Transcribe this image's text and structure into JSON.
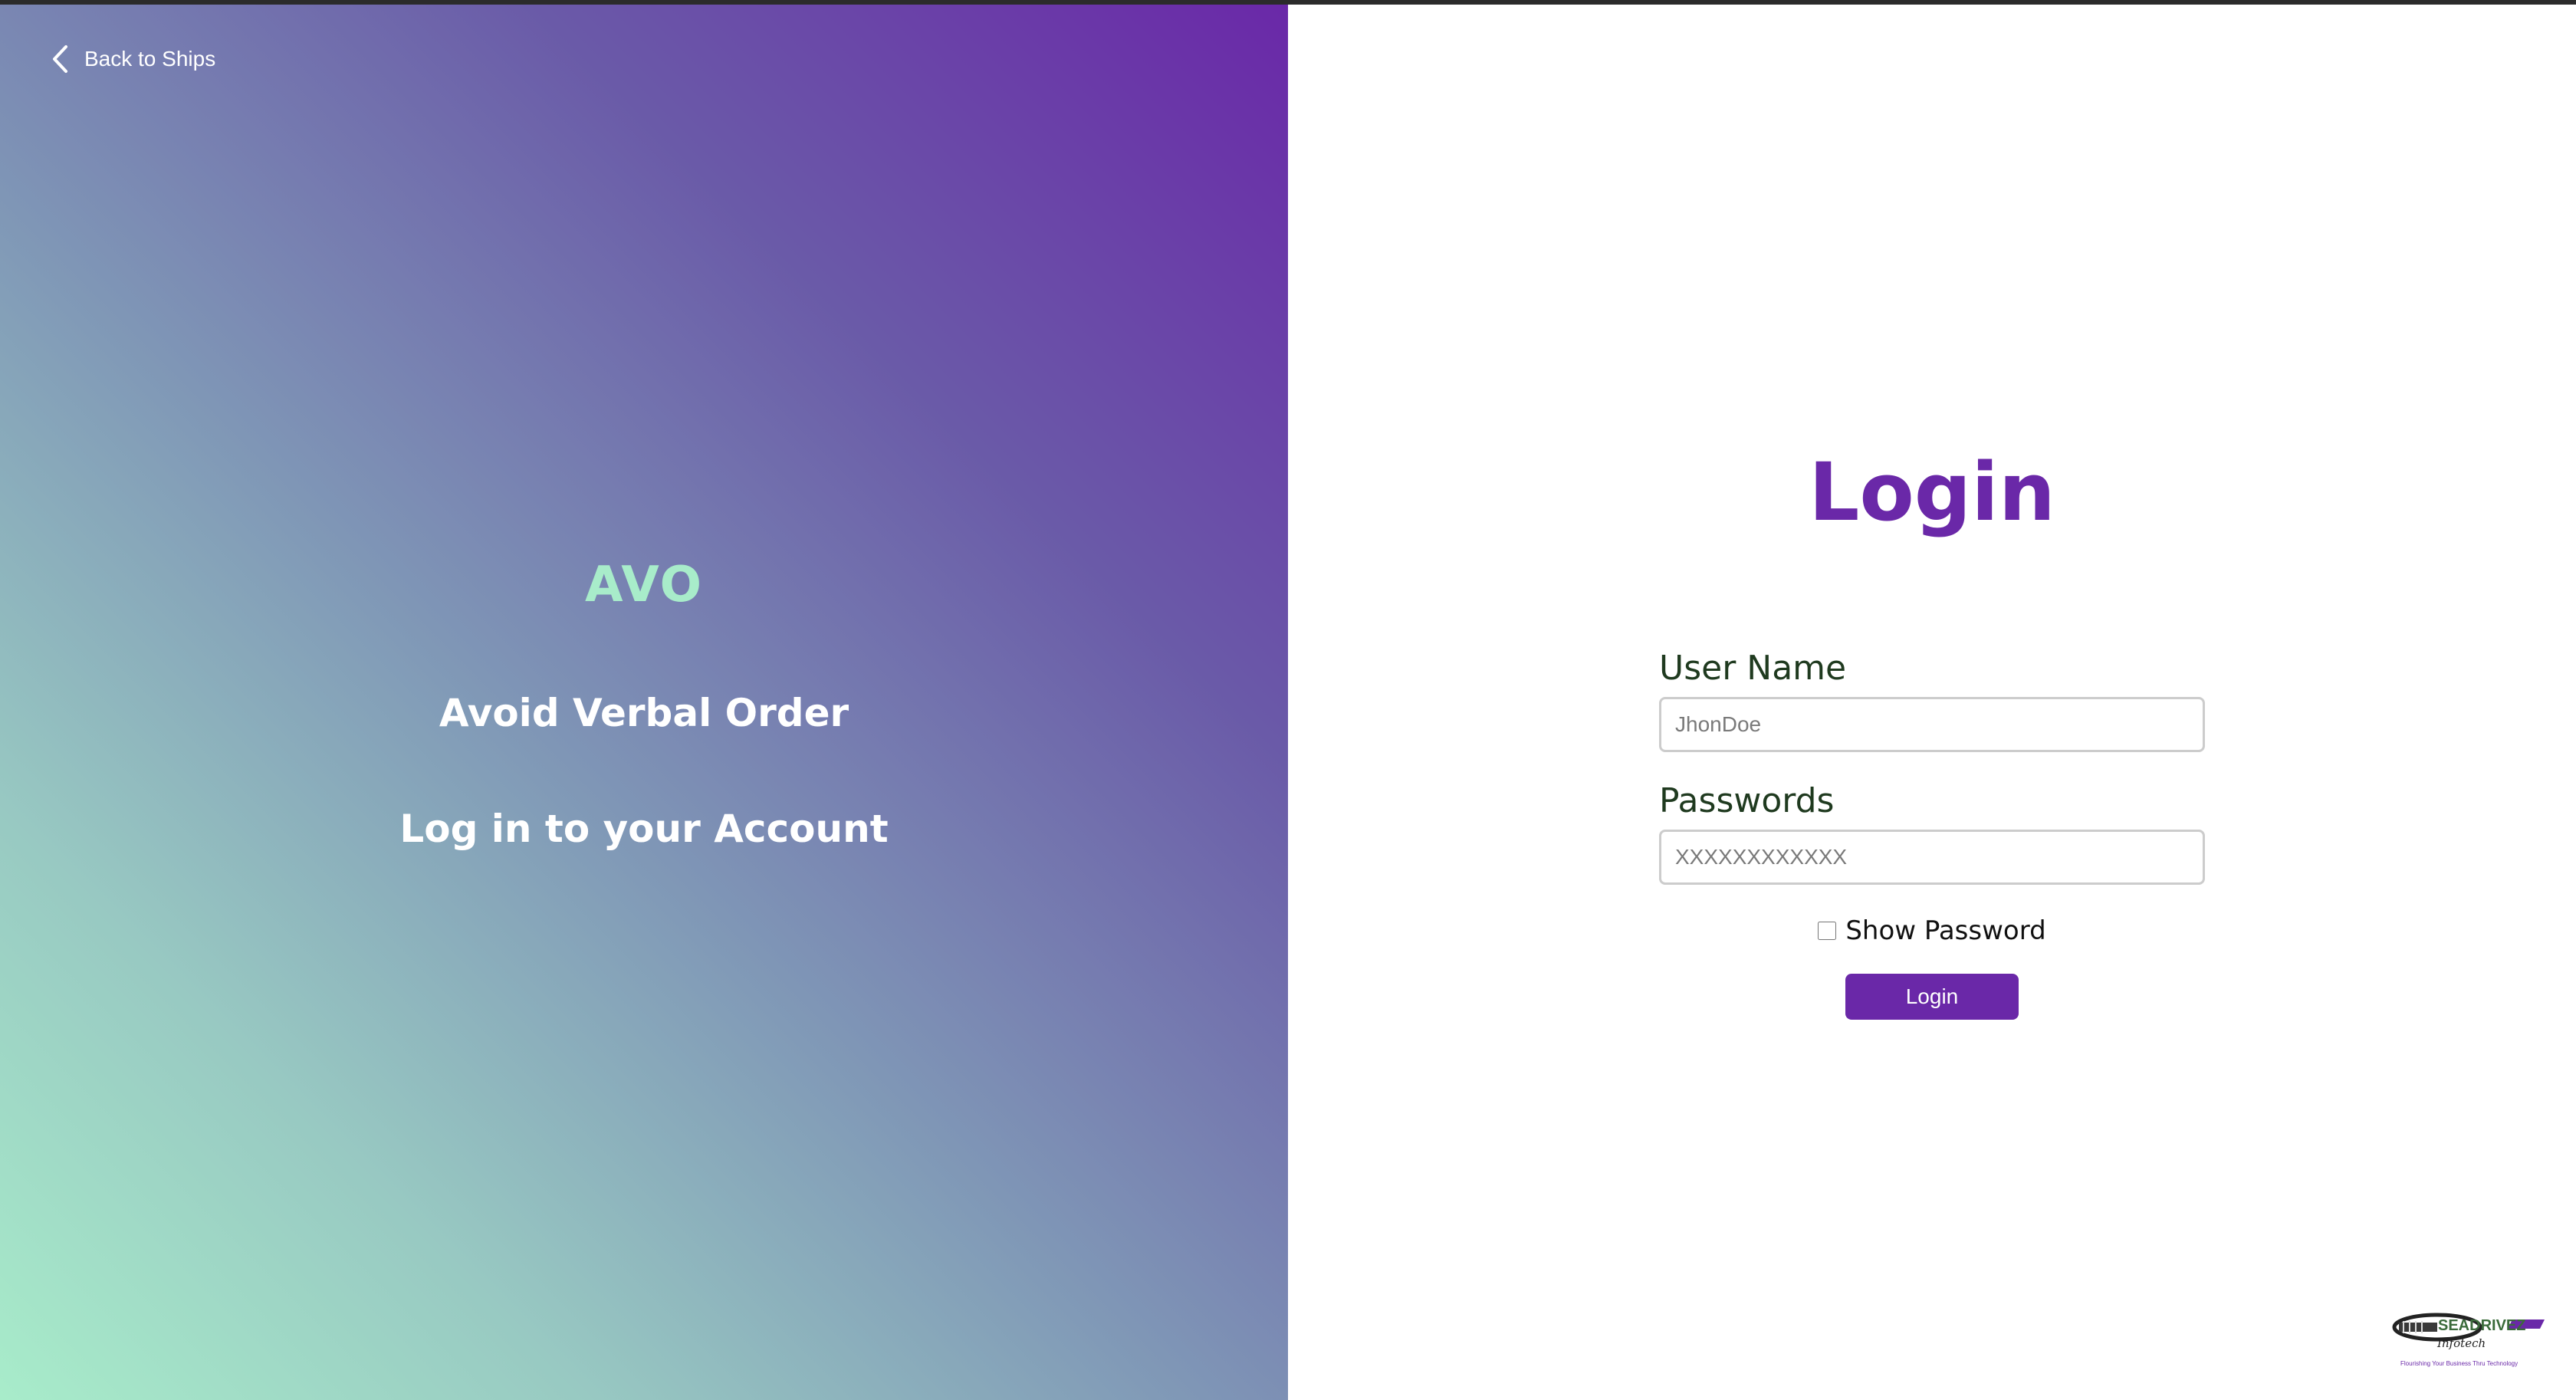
{
  "nav": {
    "back_label": "Back to Ships"
  },
  "brand": {
    "title": "AVO",
    "subtitle": "Avoid Verbal Order",
    "cta": "Log in to your Account"
  },
  "login": {
    "heading": "Login",
    "username_label": "User Name",
    "username_placeholder": "JhonDoe",
    "password_label": "Passwords",
    "password_placeholder": "XXXXXXXXXXXX",
    "show_password_label": "Show Password",
    "show_password_checked": false,
    "submit_label": "Login"
  },
  "logo": {
    "name": "SEADRIVEZ",
    "script": "Infotech",
    "tagline": "Flourishing Your Business Thru Technology"
  },
  "colors": {
    "accent": "#6a28a8",
    "brand_green": "#a8ecca",
    "label_text": "#1f3a1f"
  }
}
